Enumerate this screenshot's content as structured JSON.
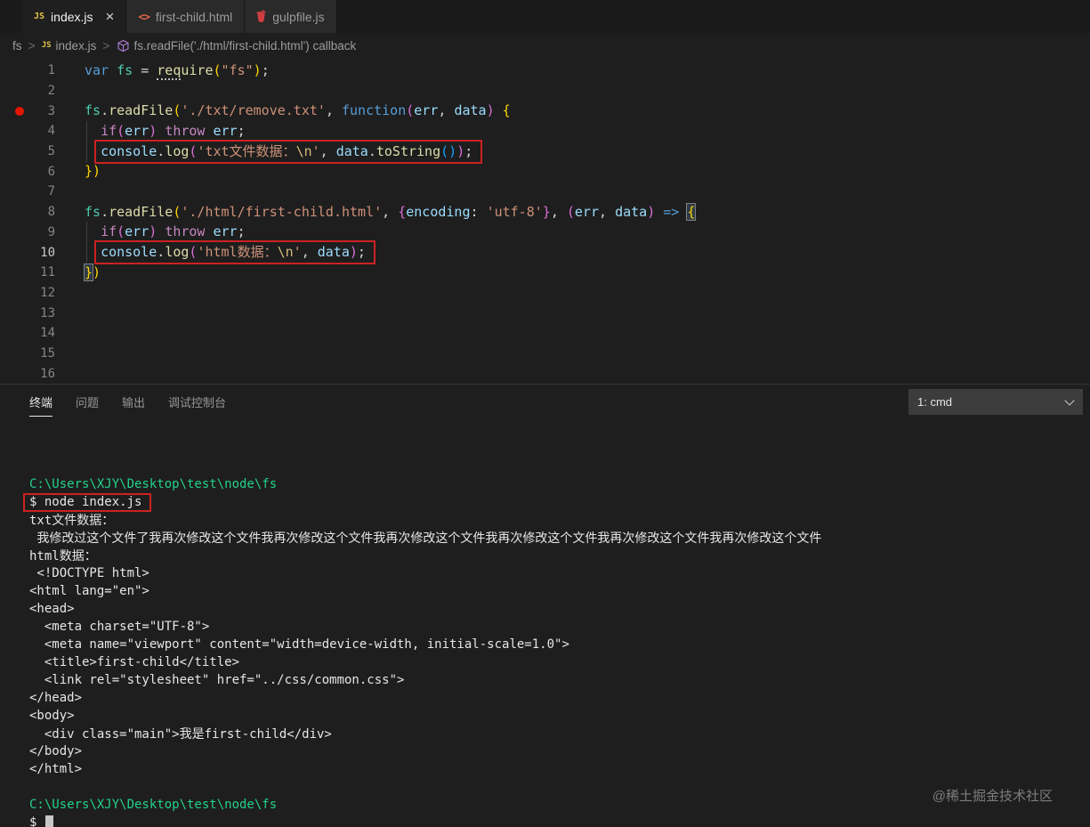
{
  "colors": {
    "annotation_red": "#cc2222",
    "breakpoint_red": "#e51400",
    "terminal_green": "#23d18b",
    "editor_background": "#1e1e1e"
  },
  "tabs": [
    {
      "label": "index.js",
      "icon": "js-icon",
      "active": true,
      "close_label": "×"
    },
    {
      "label": "first-child.html",
      "icon": "html-icon",
      "active": false
    },
    {
      "label": "gulpfile.js",
      "icon": "gulp-icon",
      "active": false
    }
  ],
  "breadcrumb": {
    "root": "fs",
    "file": "index.js",
    "file_icon": "js-icon",
    "symbol_icon": "symbol-method-icon",
    "symbol": "fs.readFile('./html/first-child.html') callback"
  },
  "editor": {
    "lines": [
      {
        "num": 1,
        "tokens": [
          {
            "t": "var",
            "c": "kw"
          },
          {
            "t": " ",
            "c": "pun"
          },
          {
            "t": "fs",
            "c": "type"
          },
          {
            "t": " = ",
            "c": "pun"
          },
          {
            "t": "req",
            "c": "fn",
            "u": true
          },
          {
            "t": "uire",
            "c": "fn"
          },
          {
            "t": "(",
            "c": "b1"
          },
          {
            "t": "\"fs\"",
            "c": "str"
          },
          {
            "t": ")",
            "c": "b1"
          },
          {
            "t": ";",
            "c": "pun"
          }
        ]
      },
      {
        "num": 2,
        "tokens": []
      },
      {
        "num": 3,
        "breakpoint": true,
        "tokens": [
          {
            "t": "fs",
            "c": "type"
          },
          {
            "t": ".",
            "c": "pun"
          },
          {
            "t": "readFile",
            "c": "fn"
          },
          {
            "t": "(",
            "c": "b1"
          },
          {
            "t": "'./txt/remove.txt'",
            "c": "str"
          },
          {
            "t": ", ",
            "c": "pun"
          },
          {
            "t": "function",
            "c": "kw"
          },
          {
            "t": "(",
            "c": "b2"
          },
          {
            "t": "err",
            "c": "var"
          },
          {
            "t": ", ",
            "c": "pun"
          },
          {
            "t": "data",
            "c": "var"
          },
          {
            "t": ")",
            "c": "b2"
          },
          {
            "t": " ",
            "c": "pun"
          },
          {
            "t": "{",
            "c": "b1"
          }
        ]
      },
      {
        "num": 4,
        "guide": true,
        "indent": "  ",
        "tokens": [
          {
            "t": "if",
            "c": "ctrl"
          },
          {
            "t": "(",
            "c": "b2"
          },
          {
            "t": "err",
            "c": "var"
          },
          {
            "t": ")",
            "c": "b2"
          },
          {
            "t": " ",
            "c": "pun"
          },
          {
            "t": "throw",
            "c": "ctrl"
          },
          {
            "t": " err",
            "c": "var"
          },
          {
            "t": ";",
            "c": "pun"
          }
        ]
      },
      {
        "num": 5,
        "guide": true,
        "indent": "  ",
        "boxed": true,
        "tokens": [
          {
            "t": "console",
            "c": "var"
          },
          {
            "t": ".",
            "c": "pun"
          },
          {
            "t": "log",
            "c": "fn"
          },
          {
            "t": "(",
            "c": "b2"
          },
          {
            "t": "'txt文件数据：",
            "c": "str"
          },
          {
            "t": "\\n",
            "c": "esc"
          },
          {
            "t": "'",
            "c": "str"
          },
          {
            "t": ", ",
            "c": "pun"
          },
          {
            "t": "data",
            "c": "var"
          },
          {
            "t": ".",
            "c": "pun"
          },
          {
            "t": "toString",
            "c": "fn"
          },
          {
            "t": "(",
            "c": "b3"
          },
          {
            "t": ")",
            "c": "b3"
          },
          {
            "t": ")",
            "c": "b2"
          },
          {
            "t": ";",
            "c": "pun"
          }
        ]
      },
      {
        "num": 6,
        "tokens": [
          {
            "t": "}",
            "c": "b1"
          },
          {
            "t": ")",
            "c": "b1"
          }
        ]
      },
      {
        "num": 7,
        "tokens": []
      },
      {
        "num": 8,
        "tokens": [
          {
            "t": "fs",
            "c": "type"
          },
          {
            "t": ".",
            "c": "pun"
          },
          {
            "t": "readFile",
            "c": "fn"
          },
          {
            "t": "(",
            "c": "b1"
          },
          {
            "t": "'./html/first-child.html'",
            "c": "str"
          },
          {
            "t": ", ",
            "c": "pun"
          },
          {
            "t": "{",
            "c": "b2"
          },
          {
            "t": "encoding",
            "c": "var"
          },
          {
            "t": ": ",
            "c": "pun"
          },
          {
            "t": "'utf-8'",
            "c": "str"
          },
          {
            "t": "}",
            "c": "b2"
          },
          {
            "t": ", ",
            "c": "pun"
          },
          {
            "t": "(",
            "c": "b2"
          },
          {
            "t": "err",
            "c": "var"
          },
          {
            "t": ", ",
            "c": "pun"
          },
          {
            "t": "data",
            "c": "var"
          },
          {
            "t": ")",
            "c": "b2"
          },
          {
            "t": " ",
            "c": "pun"
          },
          {
            "t": "=>",
            "c": "kw"
          },
          {
            "t": " ",
            "c": "pun"
          },
          {
            "t": "{",
            "c": "b1",
            "frame": true
          }
        ]
      },
      {
        "num": 9,
        "guide": true,
        "indent": "  ",
        "tokens": [
          {
            "t": "if",
            "c": "ctrl"
          },
          {
            "t": "(",
            "c": "b2"
          },
          {
            "t": "err",
            "c": "var"
          },
          {
            "t": ")",
            "c": "b2"
          },
          {
            "t": " ",
            "c": "pun"
          },
          {
            "t": "throw",
            "c": "ctrl"
          },
          {
            "t": " err",
            "c": "var"
          },
          {
            "t": ";",
            "c": "pun"
          }
        ]
      },
      {
        "num": 10,
        "guide": true,
        "indent": "  ",
        "boxed": true,
        "active": true,
        "tokens": [
          {
            "t": "console",
            "c": "var"
          },
          {
            "t": ".",
            "c": "pun"
          },
          {
            "t": "log",
            "c": "fn"
          },
          {
            "t": "(",
            "c": "b2"
          },
          {
            "t": "'html数据：",
            "c": "str"
          },
          {
            "t": "\\n",
            "c": "esc"
          },
          {
            "t": "'",
            "c": "str"
          },
          {
            "t": ", ",
            "c": "pun"
          },
          {
            "t": "data",
            "c": "var"
          },
          {
            "t": ")",
            "c": "b2"
          },
          {
            "t": ";",
            "c": "pun"
          }
        ]
      },
      {
        "num": 11,
        "tokens": [
          {
            "t": "}",
            "c": "b1",
            "frame": true
          },
          {
            "t": ")",
            "c": "b1"
          }
        ]
      },
      {
        "num": 12,
        "tokens": []
      },
      {
        "num": 13,
        "tokens": []
      },
      {
        "num": 14,
        "tokens": []
      },
      {
        "num": 15,
        "tokens": []
      },
      {
        "num": 16,
        "tokens": []
      }
    ]
  },
  "panel": {
    "tabs": [
      {
        "label": "终端",
        "active": true
      },
      {
        "label": "问题",
        "active": false
      },
      {
        "label": "输出",
        "active": false
      },
      {
        "label": "调试控制台",
        "active": false
      }
    ],
    "dropdown": "1: cmd",
    "dropdown_icon": "chevron-down-icon"
  },
  "terminal": {
    "lines": [
      {
        "text": "C:\\Users\\XJY\\Desktop\\test\\node\\fs",
        "color": "green"
      },
      {
        "text": "$ node index.js",
        "boxed": true
      },
      {
        "text": "txt文件数据："
      },
      {
        "text": " 我修改过这个文件了我再次修改这个文件我再次修改这个文件我再次修改这个文件我再次修改这个文件我再次修改这个文件我再次修改这个文件"
      },
      {
        "text": "html数据："
      },
      {
        "text": " <!DOCTYPE html>"
      },
      {
        "text": "<html lang=\"en\">"
      },
      {
        "text": "<head>"
      },
      {
        "text": "  <meta charset=\"UTF-8\">"
      },
      {
        "text": "  <meta name=\"viewport\" content=\"width=device-width, initial-scale=1.0\">"
      },
      {
        "text": "  <title>first-child</title>"
      },
      {
        "text": "  <link rel=\"stylesheet\" href=\"../css/common.css\">"
      },
      {
        "text": "</head>"
      },
      {
        "text": "<body>"
      },
      {
        "text": "  <div class=\"main\">我是first-child</div>"
      },
      {
        "text": "</body>"
      },
      {
        "text": "</html>"
      },
      {
        "text": ""
      },
      {
        "text": "C:\\Users\\XJY\\Desktop\\test\\node\\fs",
        "color": "green"
      },
      {
        "text": "$ ",
        "cursor": true
      }
    ]
  },
  "watermark": "@稀土掘金技术社区"
}
